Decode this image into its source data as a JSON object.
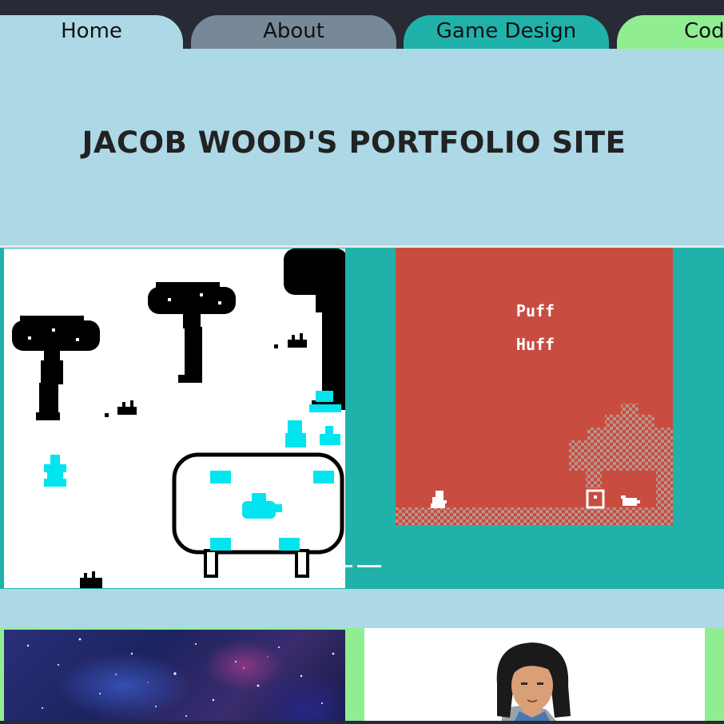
{
  "nav": {
    "tabs": [
      {
        "label": "Home",
        "bg": "#add8e6"
      },
      {
        "label": "About",
        "bg": "#778899"
      },
      {
        "label": "Game Design",
        "bg": "#20b2aa"
      },
      {
        "label": "Cod",
        "bg": "#90ee90"
      }
    ]
  },
  "hero": {
    "title": "JACOB WOOD'S PORTFOLIO SITE",
    "bg": "#add8e6"
  },
  "games": {
    "right_screen": {
      "line1": "Puff",
      "line2": "Huff"
    }
  },
  "colors": {
    "teal": "#20b2aa",
    "light_blue": "#add8e6",
    "light_green": "#90ee90",
    "slate": "#778899",
    "dark": "#282a36",
    "game_red": "#c94c40",
    "cyan_sprite": "#00e5ee"
  },
  "icons": [
    "tree-sprite",
    "teapot-sprite",
    "player-sprite",
    "door-sprite",
    "pig-sprite"
  ]
}
